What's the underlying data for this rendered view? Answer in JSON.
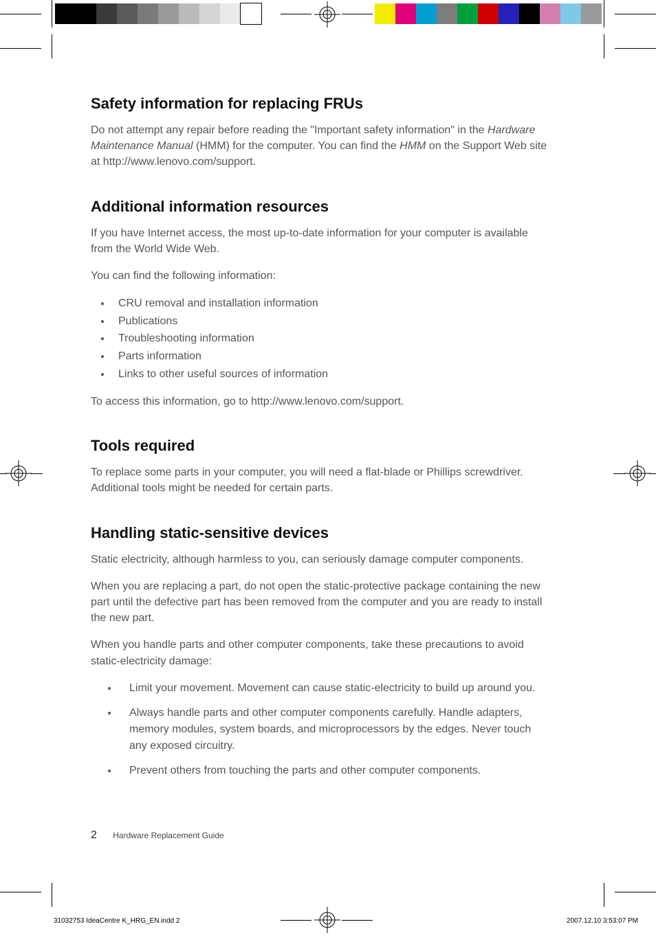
{
  "colorbar_left": [
    "#000000",
    "#000000",
    "#3a3a3a",
    "#5a5a5a",
    "#7a7a7a",
    "#9a9a9a",
    "#bababa",
    "#d5d5d5",
    "#eaeaea",
    "#ffffff"
  ],
  "colorbar_right": [
    "#f3ea00",
    "#e0007a",
    "#00a0d4",
    "#7d7d7d",
    "#00a03c",
    "#cf0000",
    "#2222bb",
    "#000000",
    "#d37fb0",
    "#7fc9e6",
    "#9a9a9a"
  ],
  "sections": {
    "s1": {
      "heading": "Safety information for replacing FRUs",
      "p1_a": "Do not attempt any repair before reading the \"Important safety information\" in the ",
      "p1_i1": "Hardware Maintenance Manual",
      "p1_b": " (HMM) for the computer. You can find the ",
      "p1_i2": "HMM",
      "p1_c": " on the Support Web site at http://www.lenovo.com/support."
    },
    "s2": {
      "heading": "Additional information resources",
      "p1": "If you have Internet access, the most up-to-date information for your computer is available from the World Wide Web.",
      "p2": "You can find the following information:",
      "list": [
        "CRU removal and installation information",
        "Publications",
        "Troubleshooting information",
        "Parts information",
        "Links to other useful sources of information"
      ],
      "p3": "To access this information, go to http://www.lenovo.com/support."
    },
    "s3": {
      "heading": "Tools required",
      "p1": "To replace some parts in your computer, you will need a flat-blade or Phillips screwdriver. Additional tools might be needed for certain parts."
    },
    "s4": {
      "heading": "Handling static-sensitive devices",
      "p1": "Static electricity, although harmless to you, can seriously damage computer components.",
      "p2": "When you are replacing a part, do not open the static-protective package containing the new part until the defective part has been removed from the computer and you are ready to install the new part.",
      "p3": "When you handle parts and other computer components, take these precautions to avoid static-electricity damage:",
      "list": [
        "Limit your movement. Movement can cause static-electricity to build up around you.",
        "Always handle parts and other computer components carefully. Handle adapters, memory modules, system boards, and microprocessors by the edges. Never touch any exposed circuitry.",
        "Prevent others from touching the parts and other computer components."
      ]
    }
  },
  "footer": {
    "page_number": "2",
    "title": "Hardware Replacement Guide"
  },
  "imprint": {
    "left": "31032753 IdeaCentre K_HRG_EN.indd   2",
    "right": "2007.12.10   3:53:07 PM"
  }
}
